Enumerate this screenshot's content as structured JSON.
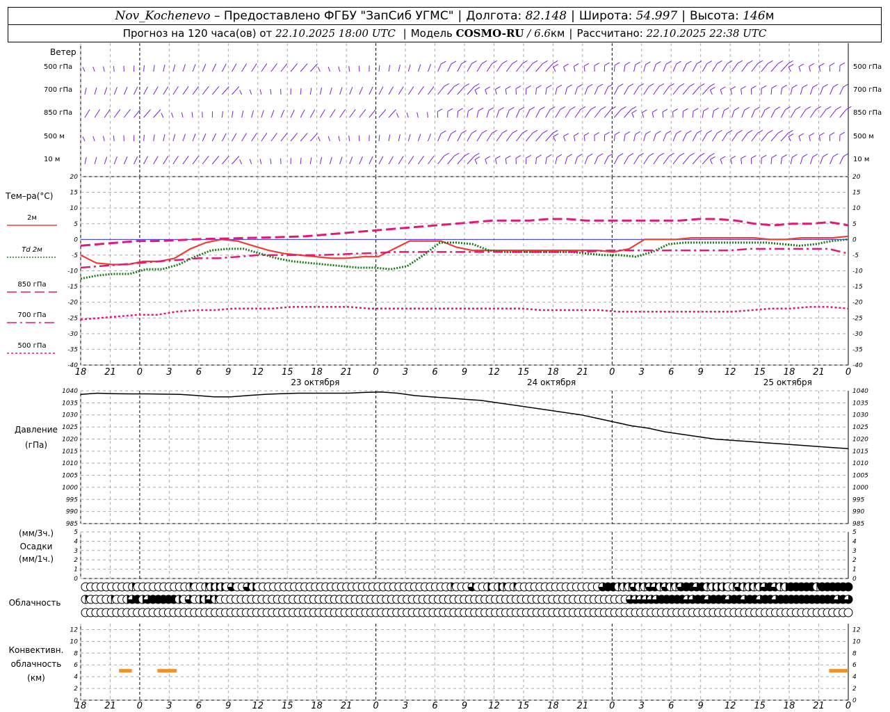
{
  "header": {
    "station": "Nov_Kochenevo",
    "provider": "– Предоставлено ФГБУ \"ЗапСиб УГМС\"",
    "lon_label": "Долгота:",
    "lon_value": "82.148",
    "lat_label": "Широта:",
    "lat_value": "54.997",
    "alt_label": "Высота:",
    "alt_value": "146",
    "alt_unit": "м",
    "forecast_label": "Прогноз на 120 часа(ов) от",
    "forecast_time": "22.10.2025 18:00 UTC",
    "model_label": "Модель",
    "model_name": "COSMO-RU",
    "model_res": "/ 6.6",
    "model_res_unit": "км",
    "calc_label": "Рассчитано:",
    "calc_time": "22.10.2025 22:38 UTC"
  },
  "wind_panel": {
    "title": "Ветер",
    "levels": [
      "500 гПа",
      "700 гПа",
      "850 гПа",
      "500 м",
      "10 м"
    ],
    "color": "#7b1fd6"
  },
  "time_axis": {
    "hour_labels": [
      "18",
      "21",
      "0",
      "3",
      "6",
      "9",
      "12",
      "15",
      "18",
      "21",
      "0",
      "3",
      "6",
      "9",
      "12",
      "15",
      "18",
      "21",
      "0",
      "3",
      "6",
      "9",
      "12",
      "15",
      "18",
      "21",
      "0"
    ],
    "date_labels": [
      "23 октября",
      "24 октября",
      "25 октября"
    ]
  },
  "chart_data": [
    {
      "type": "line",
      "panel": "temperature",
      "ylabel": "Тем–ра(°С)",
      "ylim": [
        -40,
        20
      ],
      "yticks": [
        20,
        15,
        10,
        5,
        0,
        -5,
        -10,
        -15,
        -20,
        -25,
        -30,
        -35,
        -40
      ],
      "x_hours": [
        0,
        3,
        6,
        9,
        12,
        15,
        18,
        21,
        24,
        27,
        30,
        33,
        36,
        39,
        42,
        45,
        48,
        51,
        54,
        57,
        60,
        63,
        66,
        69,
        72,
        75,
        78,
        81,
        84,
        87,
        90,
        93,
        96,
        99,
        102,
        105,
        108,
        111,
        114,
        117,
        120
      ],
      "series": [
        {
          "name": "2м",
          "color": "#f03c32",
          "style": "solid",
          "values": [
            -5,
            -7.5,
            -8,
            -8,
            -7,
            -7,
            -6,
            -3,
            -1,
            0,
            -0.5,
            -2,
            -3.5,
            -4.5,
            -5,
            -5.5,
            -6,
            -6,
            -5.5,
            -5.5,
            -3,
            -0.5,
            -0.5,
            -0.5,
            -2.5,
            -3.5,
            -3.5,
            -3.5,
            -3.5,
            -3.5,
            -3.5,
            -3.5,
            -3.5,
            -3.5,
            -4,
            -3,
            0,
            0,
            0,
            0.5,
            0.5,
            0.5,
            0.5,
            0.5,
            0,
            0,
            0.5,
            0.5,
            0.5,
            1
          ]
        },
        {
          "name": "Td 2м",
          "color": "#1a7a1a",
          "style": "dotted",
          "values": [
            -12.5,
            -11.5,
            -11,
            -11,
            -9.5,
            -9.5,
            -8,
            -5.5,
            -3.5,
            -3,
            -3,
            -4.5,
            -6,
            -7,
            -7.5,
            -8,
            -8.5,
            -9,
            -9,
            -9.5,
            -8.5,
            -5,
            -1,
            -1,
            -1.5,
            -3.5,
            -4,
            -4,
            -4,
            -4,
            -4,
            -4.5,
            -5,
            -5,
            -5.5,
            -4,
            -1.5,
            -1,
            -1,
            -1,
            -1,
            -1,
            -1,
            -1.5,
            -2,
            -1.5,
            -0.5,
            0
          ]
        },
        {
          "name": "850 гПа",
          "color": "#e0197a",
          "style": "dash",
          "values": [
            -2,
            -1.5,
            -1,
            -0.5,
            -0.5,
            -0.3,
            0,
            0.2,
            0.3,
            0.5,
            0.6,
            0.8,
            1,
            1.5,
            2,
            2.5,
            3,
            3.5,
            4,
            4.5,
            5,
            5.5,
            6,
            6,
            6,
            6.5,
            6.5,
            6,
            6,
            6,
            6,
            6,
            6,
            6.5,
            6.5,
            6,
            5,
            4.5,
            5,
            5,
            5.5,
            4.5
          ]
        },
        {
          "name": "700 гПа",
          "color": "#e0197a",
          "style": "dashdot",
          "values": [
            -9,
            -8.5,
            -8,
            -7.5,
            -7,
            -6.5,
            -6,
            -6,
            -5.5,
            -5,
            -5,
            -5,
            -5,
            -4.8,
            -4.5,
            -4.3,
            -4,
            -4,
            -4,
            -4,
            -4,
            -4,
            -4,
            -4,
            -4,
            -4,
            -3.8,
            -3.5,
            -3.5,
            -3.5,
            -3.5,
            -3.5,
            -3.5,
            -3.5,
            -3,
            -3,
            -3,
            -3,
            -3,
            -4.5
          ]
        },
        {
          "name": "500 гПа",
          "color": "#e0197a",
          "style": "dense",
          "values": [
            -25.5,
            -25,
            -24.5,
            -24,
            -24,
            -23,
            -22.5,
            -22.5,
            -22,
            -22,
            -22,
            -21.5,
            -21.5,
            -21.5,
            -21.5,
            -22,
            -22,
            -22,
            -22,
            -22,
            -22,
            -22,
            -22,
            -22,
            -22.5,
            -22.5,
            -22.5,
            -22.5,
            -23,
            -23,
            -23,
            -23,
            -23,
            -23,
            -23,
            -22.5,
            -22,
            -22,
            -21.5,
            -21.5,
            -22
          ]
        }
      ]
    },
    {
      "type": "line",
      "panel": "pressure",
      "ylabel": "Давление",
      "ylabel2": "(гПа)",
      "ylim": [
        985,
        1040
      ],
      "yticks": [
        1040,
        1035,
        1030,
        1025,
        1020,
        1015,
        1010,
        1005,
        1000,
        995,
        990,
        985
      ],
      "x_hours": [
        0,
        3,
        6,
        9,
        12,
        15,
        18,
        21,
        24,
        27,
        30,
        33,
        36,
        39,
        42,
        45,
        48,
        51,
        54,
        57,
        60,
        63,
        66,
        69,
        72,
        75,
        78,
        81,
        84,
        87,
        90,
        93,
        96,
        99,
        102,
        105,
        108,
        111,
        114,
        117,
        120
      ],
      "series": [
        {
          "name": "",
          "color": "#000000",
          "values": [
            1038.5,
            1039,
            1038.8,
            1038.7,
            1038.7,
            1038.6,
            1038.5,
            1038,
            1037.5,
            1037.5,
            1038,
            1038.5,
            1038.8,
            1039,
            1039,
            1039,
            1039,
            1039.3,
            1039.5,
            1039,
            1038,
            1037.5,
            1037,
            1036.5,
            1036,
            1035,
            1034,
            1033,
            1032,
            1031,
            1030,
            1028.5,
            1027,
            1025.5,
            1024.5,
            1023,
            1022,
            1021,
            1020,
            1019.5,
            1019,
            1018.5,
            1018,
            1017.5,
            1017,
            1016.5,
            1016
          ]
        }
      ]
    },
    {
      "type": "bar",
      "panel": "precipitation",
      "ylabel": "(мм/3ч.)",
      "ylabel2": "Осадки",
      "ylabel3": "(мм/1ч.)",
      "ylim": [
        0,
        5
      ],
      "yticks": [
        5,
        4,
        3,
        2,
        1,
        0
      ],
      "values": []
    },
    {
      "type": "table",
      "panel": "cloudiness",
      "ylabel": "Облачность",
      "rows": [
        "000000000100000000001001222030032000000000000000000000000000000000000010003002021010000000000000000344111311331311344341222013121234312444441444444",
        "1000010023423444442030223100000000000000000000000000000000000000000000000000000000000000000000000000000003333334444433443444344344344344444444444343",
        "0000000000000000000000000000000000000000000000000000000000000000000000000000000000000000000000000000000000000000000000000000000000000000000000000000"
      ]
    },
    {
      "type": "bar",
      "panel": "convective",
      "ylabel": "Конвективн.",
      "ylabel2": "облачность",
      "ylabel3": "(км)",
      "ylim": [
        0,
        13
      ],
      "yticks": [
        12,
        10,
        8,
        6,
        4,
        2,
        0
      ],
      "color": "#f0902a",
      "segments": [
        [
          6,
          8,
          4.7,
          5.3
        ],
        [
          12,
          15,
          4.7,
          5.3
        ],
        [
          117,
          120,
          4.7,
          5.3
        ]
      ]
    }
  ]
}
